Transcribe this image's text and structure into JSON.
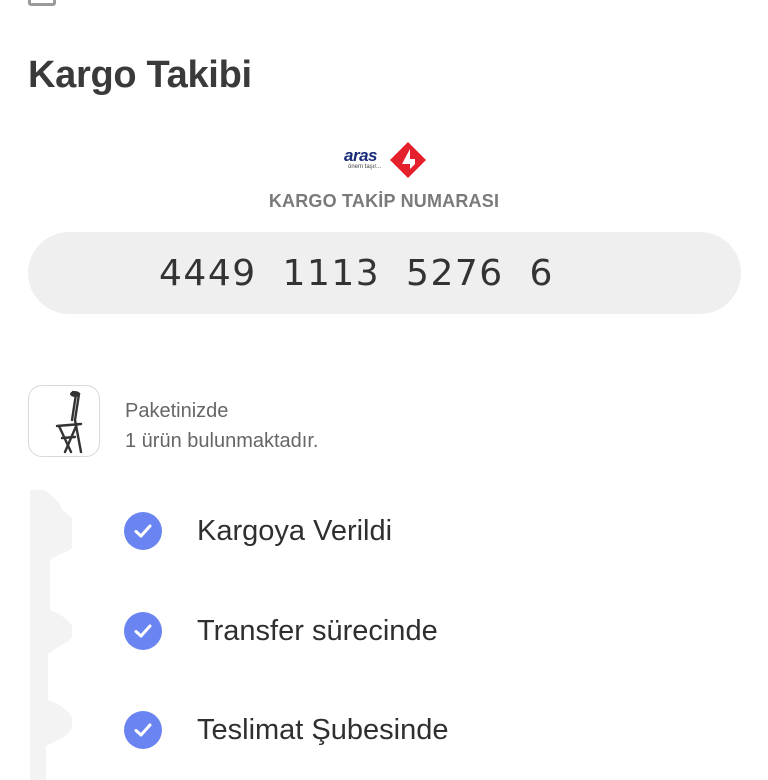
{
  "page": {
    "title": "Kargo Takibi"
  },
  "carrier": {
    "logo_text": "aras",
    "logo_tagline": "önem taşır...",
    "tracking_label": "KARGO TAKİP NUMARASI",
    "tracking_number": "4449  1113  5276  6"
  },
  "package": {
    "line1": "Paketinizde",
    "line2": "1 ürün bulunmaktadır.",
    "icon": "folding-chair-icon"
  },
  "steps": [
    {
      "label": "Kargoya Verildi",
      "done": true
    },
    {
      "label": "Transfer sürecinde",
      "done": true
    },
    {
      "label": "Teslimat Şubesinde",
      "done": true
    }
  ],
  "colors": {
    "check": "#6a85f2",
    "logo_red": "#e3202b",
    "logo_blue": "#1a2b7a",
    "tracking_box": "#efefef"
  }
}
